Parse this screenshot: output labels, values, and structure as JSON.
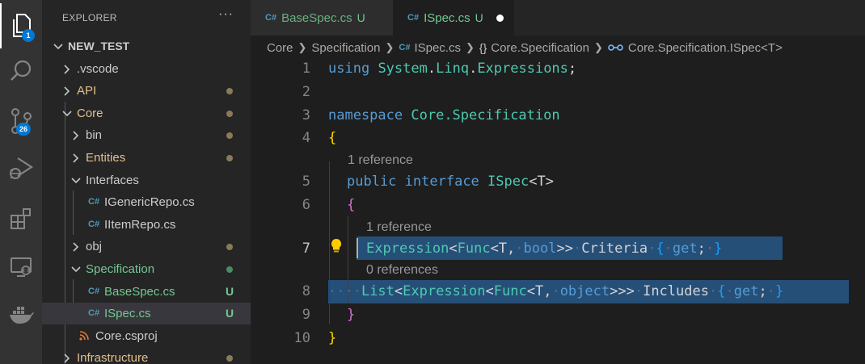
{
  "activity_bar": {
    "explorer_badge": "1",
    "scm_badge": "26"
  },
  "sidebar": {
    "title": "EXPLORER",
    "more": "···",
    "tree": [
      {
        "label": "NEW_TEST",
        "kind": "root",
        "expanded": true,
        "color": "#cccccc"
      },
      {
        "label": ".vscode",
        "kind": "folder",
        "expanded": false,
        "color": "#cccccc"
      },
      {
        "label": "API",
        "kind": "folder",
        "expanded": false,
        "color": "#e2c08d",
        "status": "modified-dot"
      },
      {
        "label": "Core",
        "kind": "folder",
        "expanded": true,
        "color": "#e2c08d",
        "status": "modified-dot"
      },
      {
        "label": "bin",
        "kind": "folder",
        "expanded": false,
        "color": "#cccccc",
        "status": "modified-dot"
      },
      {
        "label": "Entities",
        "kind": "folder",
        "expanded": false,
        "color": "#e2c08d",
        "status": "modified-dot"
      },
      {
        "label": "Interfaces",
        "kind": "folder",
        "expanded": true,
        "color": "#cccccc"
      },
      {
        "label": "IGenericRepo.cs",
        "kind": "csharp-file",
        "color": "#cccccc"
      },
      {
        "label": "IItemRepo.cs",
        "kind": "csharp-file",
        "color": "#cccccc"
      },
      {
        "label": "obj",
        "kind": "folder",
        "expanded": false,
        "color": "#cccccc",
        "status": "modified-dot"
      },
      {
        "label": "Specification",
        "kind": "folder",
        "expanded": true,
        "color": "#73c991",
        "status": "untracked-dot"
      },
      {
        "label": "BaseSpec.cs",
        "kind": "csharp-file",
        "color": "#73c991",
        "status": "U"
      },
      {
        "label": "ISpec.cs",
        "kind": "csharp-file",
        "color": "#73c991",
        "status": "U",
        "selected": true
      },
      {
        "label": "Core.csproj",
        "kind": "rss-file",
        "color": "#cccccc"
      },
      {
        "label": "Infrastructure",
        "kind": "folder",
        "expanded": false,
        "color": "#e2c08d",
        "status": "modified-dot"
      }
    ]
  },
  "tabs": [
    {
      "label": "BaseSpec.cs",
      "status": "U",
      "active": false
    },
    {
      "label": "ISpec.cs",
      "status": "U",
      "active": true,
      "dirty": true
    }
  ],
  "breadcrumb": {
    "items": [
      "Core",
      "Specification",
      "ISpec.cs",
      "Core.Specification",
      "Core.Specification.ISpec<T>"
    ],
    "icons": [
      "",
      "",
      "C#",
      "{}",
      "interface-icon"
    ]
  },
  "editor": {
    "line_numbers": [
      "1",
      "2",
      "3",
      "4",
      "5",
      "6",
      "7",
      "8",
      "9",
      "10"
    ],
    "codelens": [
      "1 reference",
      "1 reference",
      "0 references"
    ],
    "tokens": {
      "l1_kw": "using",
      "l1_ns1": "System",
      "l1_dot1": ".",
      "l1_ns2": "Linq",
      "l1_dot2": ".",
      "l1_ns3": "Expressions",
      "l1_semi": ";",
      "l3_kw": "namespace",
      "l3_ns": "Core.Specification",
      "l4_brace": "{",
      "l5_kw1": "public",
      "l5_kw2": "interface",
      "l5_name": "ISpec",
      "l5_gen": "<T>",
      "l6_brace": "{",
      "l7_t1": "Expression",
      "l7_p1": "<",
      "l7_t2": "Func",
      "l7_p2": "<T,",
      "l7_kw": "bool",
      "l7_p3": ">>",
      "l7_prop": "Criteria",
      "l7_b1": "{",
      "l7_get": "get",
      "l7_semi": ";",
      "l7_b2": "}",
      "l8_t1": "List",
      "l8_p1": "<",
      "l8_t2": "Expression",
      "l8_p2": "<",
      "l8_t3": "Func",
      "l8_p3": "<T,",
      "l8_kw": "object",
      "l8_p4": ">>>",
      "l8_prop": "Includes",
      "l8_b1": "{",
      "l8_get": "get",
      "l8_semi": ";",
      "l8_b2": "}",
      "l9_brace": "}",
      "l10_brace": "}"
    }
  },
  "colors": {
    "activity_bar": "#333333",
    "sidebar": "#252526",
    "editor": "#1e1e1e",
    "keyword": "#569cd6",
    "type": "#4ec9b0",
    "untracked": "#73c991",
    "modified": "#e2c08d",
    "selection": "#264f78",
    "badge": "#0078d4"
  }
}
